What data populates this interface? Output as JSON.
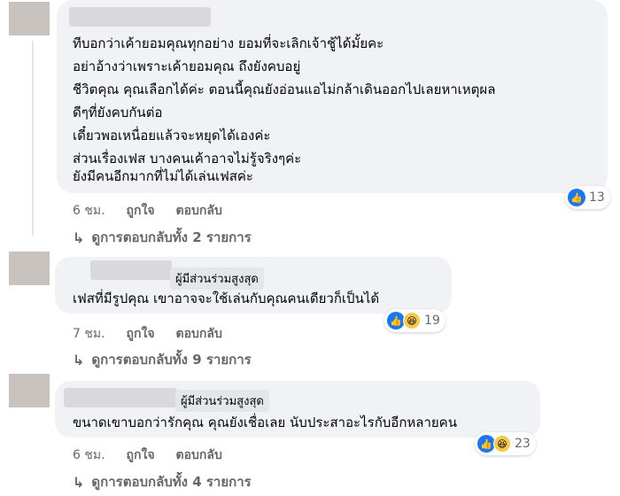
{
  "comments": [
    {
      "badge": "",
      "lines": [
        "ทีบอกว่าเค้ายอมคุณทุกอย่าง ยอมที่จะเลิกเจ้าชู้ได้มั้ยคะ",
        "อย่าอ้างว่าเพราะเค้ายอมคุณ ถึงยังคบอยู่",
        "ชีวิตคุณ คุณเลือกได้ค่ะ ตอนนี้คุณยังอ่อนแอไม่กล้าเดินออกไปเลยหาเหตุผล",
        "ดีๆที่ยังคบกันต่อ",
        "เดี๋ยวพอเหนื่อยแล้วจะหยุดได้เองค่ะ",
        "ส่วนเรื่องเฟส บางคนเค้าอาจไม่รู้จริงๆค่ะ",
        "ยังมีคนอีกมากที่ไม่ได้เล่นเฟสค่ะ"
      ],
      "reaction_count": "13",
      "time": "6 ชม.",
      "like": "ถูกใจ",
      "reply": "ตอบกลับ",
      "view_replies": "ดูการตอบกลับทั้ง 2 รายการ"
    },
    {
      "badge": "ผู้มีส่วนร่วมสูงสุด",
      "lines": [
        "เฟสที่มีรูปคุณ เขาอาจจะใช้เล่นกับคุณคนเดียวก็เป็นได้"
      ],
      "reaction_count": "19",
      "time": "7 ชม.",
      "like": "ถูกใจ",
      "reply": "ตอบกลับ",
      "view_replies": "ดูการตอบกลับทั้ง 9 รายการ"
    },
    {
      "badge": "ผู้มีส่วนร่วมสูงสุด",
      "lines": [
        "ขนาดเขาบอกว่ารักคุณ คุณยังเชื่อเลย นับประสาอะไรกับอีกหลายคน"
      ],
      "reaction_count": "23",
      "time": "6 ชม.",
      "like": "ถูกใจ",
      "reply": "ตอบกลับ",
      "view_replies": "ดูการตอบกลับทั้ง 4 รายการ"
    }
  ],
  "icons": {
    "like": "like-reaction-icon",
    "haha": "haha-reaction-icon",
    "reply_arrow": "reply-arrow-icon"
  }
}
